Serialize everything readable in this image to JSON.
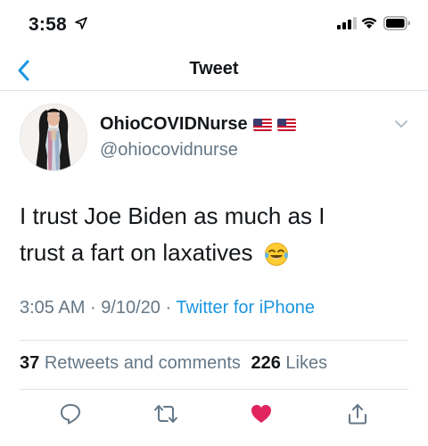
{
  "status_bar": {
    "time": "3:58",
    "icons": [
      "location-arrow-icon",
      "cellular-signal-icon",
      "wifi-icon",
      "battery-icon"
    ]
  },
  "nav": {
    "title": "Tweet",
    "back_icon": "chevron-left-icon"
  },
  "tweet": {
    "display_name": "OhioCOVIDNurse",
    "name_emoji": [
      "us-flag-icon",
      "us-flag-icon"
    ],
    "handle": "@ohiocovidnurse",
    "text_line1": "I trust Joe Biden as much as I",
    "text_line2": "trust a fart on laxatives",
    "text_emoji": "face-with-tears-of-joy-icon",
    "time": "3:05 AM",
    "date": "9/10/20",
    "separator": "·",
    "source": "Twitter for iPhone"
  },
  "stats": {
    "retweets_count": "37",
    "retweets_label": "Retweets and comments",
    "likes_count": "226",
    "likes_label": "Likes"
  },
  "actions": {
    "icons": [
      "reply-icon",
      "retweet-icon",
      "like-heart-icon",
      "share-icon"
    ],
    "liked": true
  },
  "colors": {
    "accent": "#1b95e0",
    "secondary_text": "#657786",
    "primary_text": "#14171a",
    "like_red": "#e0245e",
    "divider": "#dfe3e6"
  }
}
